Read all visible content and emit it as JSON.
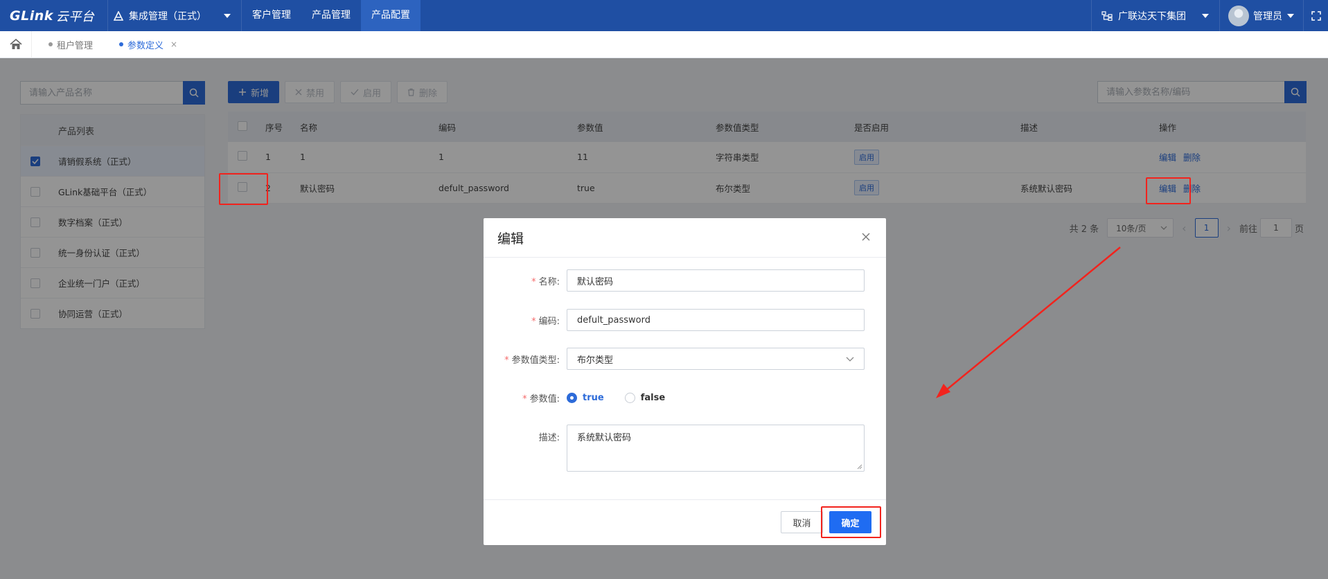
{
  "topbar": {
    "logo_main": "GLink",
    "logo_sub": "云平台",
    "system_menu": "集成管理（正式）",
    "nav": [
      {
        "label": "客户管理"
      },
      {
        "label": "产品管理"
      },
      {
        "label": "产品配置"
      }
    ],
    "org": "广联达天下集团",
    "user": "管理员",
    "colors": {
      "bar": "#1f4fa3",
      "active": "#2d63bf"
    }
  },
  "tabs": [
    {
      "label": "租户管理",
      "active": false
    },
    {
      "label": "参数定义",
      "active": true,
      "close": "×"
    }
  ],
  "left": {
    "search_placeholder": "请输入产品名称",
    "list_header": "产品列表",
    "products": [
      {
        "label": "请销假系统（正式）",
        "checked": true
      },
      {
        "label": "GLink基础平台（正式）",
        "checked": false
      },
      {
        "label": "数字档案（正式）",
        "checked": false
      },
      {
        "label": "统一身份认证（正式）",
        "checked": false
      },
      {
        "label": "企业统一门户（正式）",
        "checked": false
      },
      {
        "label": "协同运营（正式）",
        "checked": false
      }
    ]
  },
  "toolbar": {
    "add": "新增",
    "disable": "禁用",
    "enable": "启用",
    "delete": "删除",
    "search_placeholder": "请输入参数名称/编码"
  },
  "table": {
    "headers": [
      "序号",
      "名称",
      "编码",
      "参数值",
      "参数值类型",
      "是否启用",
      "描述",
      "操作"
    ],
    "rows": [
      {
        "no": "1",
        "name": "1",
        "code": "1",
        "value": "11",
        "type": "字符串类型",
        "status": "启用",
        "desc": "",
        "edit": "编辑",
        "del": "删除"
      },
      {
        "no": "2",
        "name": "默认密码",
        "code": "defult_password",
        "value": "true",
        "type": "布尔类型",
        "status": "启用",
        "desc": "系统默认密码",
        "edit": "编辑",
        "del": "删除"
      }
    ]
  },
  "pager": {
    "total": "共 2 条",
    "page_size": "10条/页",
    "current": "1",
    "goto_label": "前往",
    "goto_value": "1",
    "page_unit": "页"
  },
  "dialog": {
    "title": "编辑",
    "fields": {
      "name_label": "名称:",
      "name_value": "默认密码",
      "code_label": "编码:",
      "code_value": "defult_password",
      "type_label": "参数值类型:",
      "type_value": "布尔类型",
      "value_label": "参数值:",
      "opt_true": "true",
      "opt_false": "false",
      "selected": "true",
      "desc_label": "描述:",
      "desc_value": "系统默认密码"
    },
    "required_mark": "*",
    "cancel": "取消",
    "ok": "确定",
    "accent": "#1f6cf2"
  },
  "annotations": {
    "highlight_color": "#f2231d"
  }
}
